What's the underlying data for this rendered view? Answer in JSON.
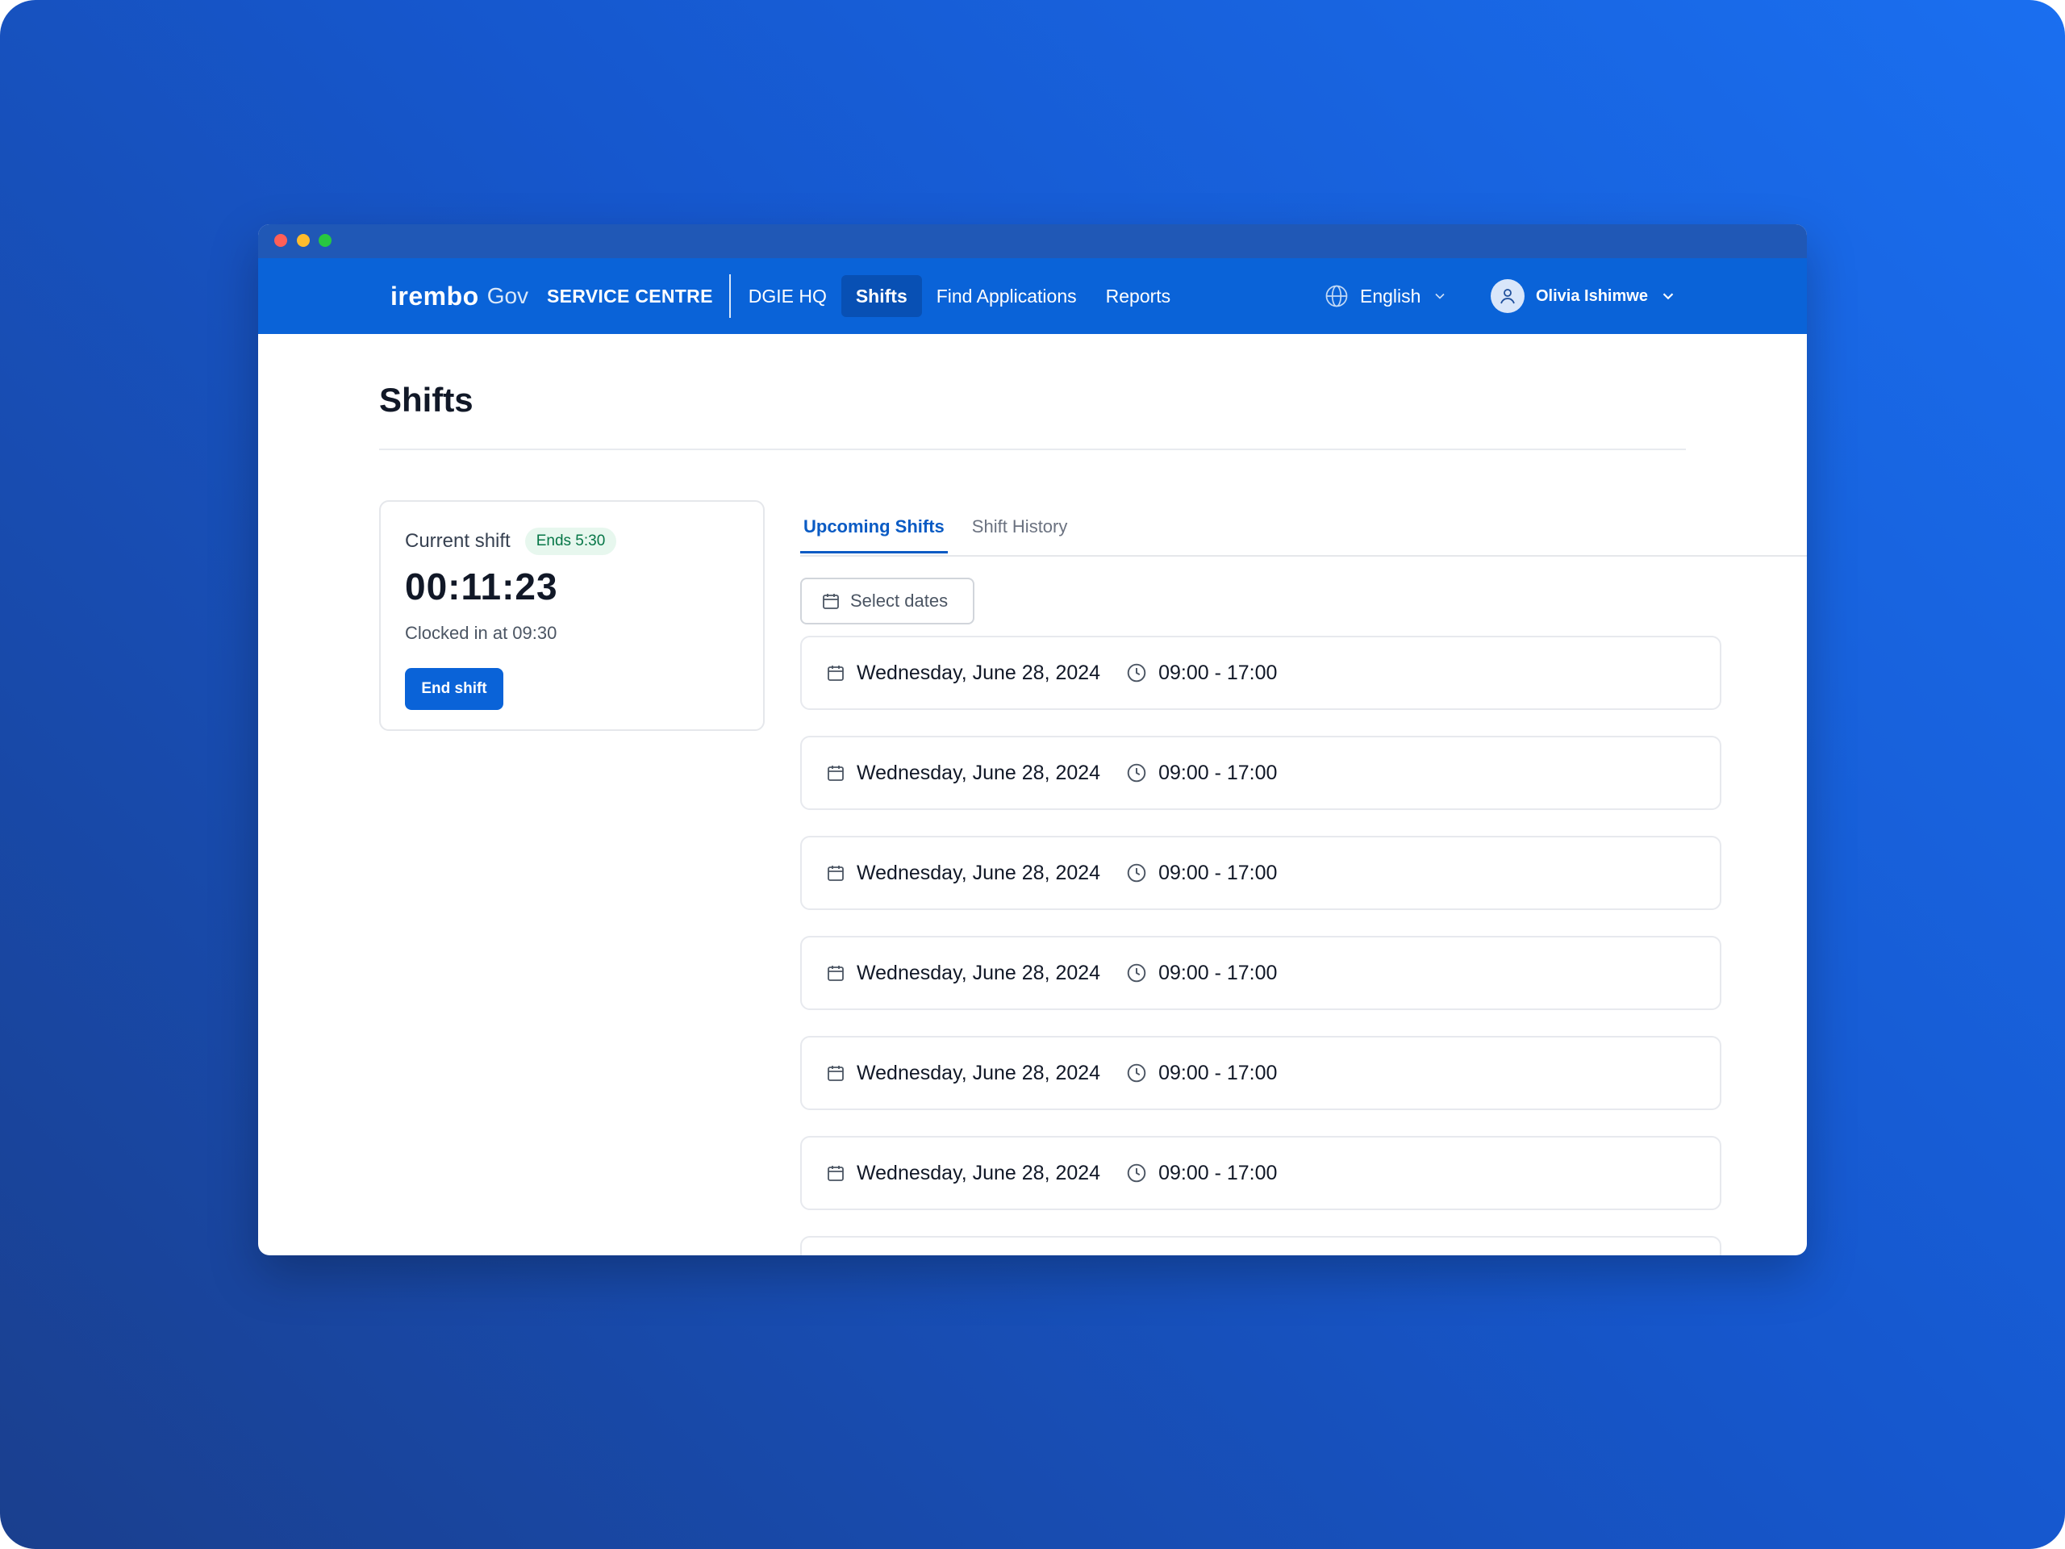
{
  "brand": {
    "logo_main": "irembo",
    "logo_sub": "Gov"
  },
  "nav": {
    "service_centre": "SERVICE CENTRE",
    "items": [
      {
        "label": "DGIE HQ"
      },
      {
        "label": "Shifts",
        "active": true
      },
      {
        "label": "Find Applications"
      },
      {
        "label": "Reports"
      }
    ],
    "language": "English",
    "user_name": "Olivia Ishimwe"
  },
  "page": {
    "title": "Shifts"
  },
  "current_shift": {
    "label": "Current shift",
    "badge": "Ends 5:30",
    "timer": "00:11:23",
    "clocked_in": "Clocked in at 09:30",
    "end_button": "End shift"
  },
  "tabs": [
    {
      "label": "Upcoming Shifts",
      "active": true
    },
    {
      "label": "Shift History"
    }
  ],
  "filter": {
    "select_dates_label": "Select dates"
  },
  "shifts": [
    {
      "date": "Wednesday, June 28, 2024",
      "time": "09:00 - 17:00"
    },
    {
      "date": "Wednesday, June 28, 2024",
      "time": "09:00 - 17:00"
    },
    {
      "date": "Wednesday, June 28, 2024",
      "time": "09:00 - 17:00"
    },
    {
      "date": "Wednesday, June 28, 2024",
      "time": "09:00 - 17:00"
    },
    {
      "date": "Wednesday, June 28, 2024",
      "time": "09:00 - 17:00"
    },
    {
      "date": "Wednesday, June 28, 2024",
      "time": "09:00 - 17:00"
    },
    {
      "date": "",
      "time": ""
    }
  ],
  "colors": {
    "nav_bg": "#0a63d8",
    "nav_active": "#0850b4",
    "accent": "#0a5bc4",
    "badge_text": "#067647",
    "badge_bg": "#e7f7ee"
  },
  "icons": {
    "language": "globe-icon",
    "dropdown": "chevron-down-icon",
    "user": "user-icon",
    "date": "calendar-icon",
    "time": "clock-icon"
  }
}
